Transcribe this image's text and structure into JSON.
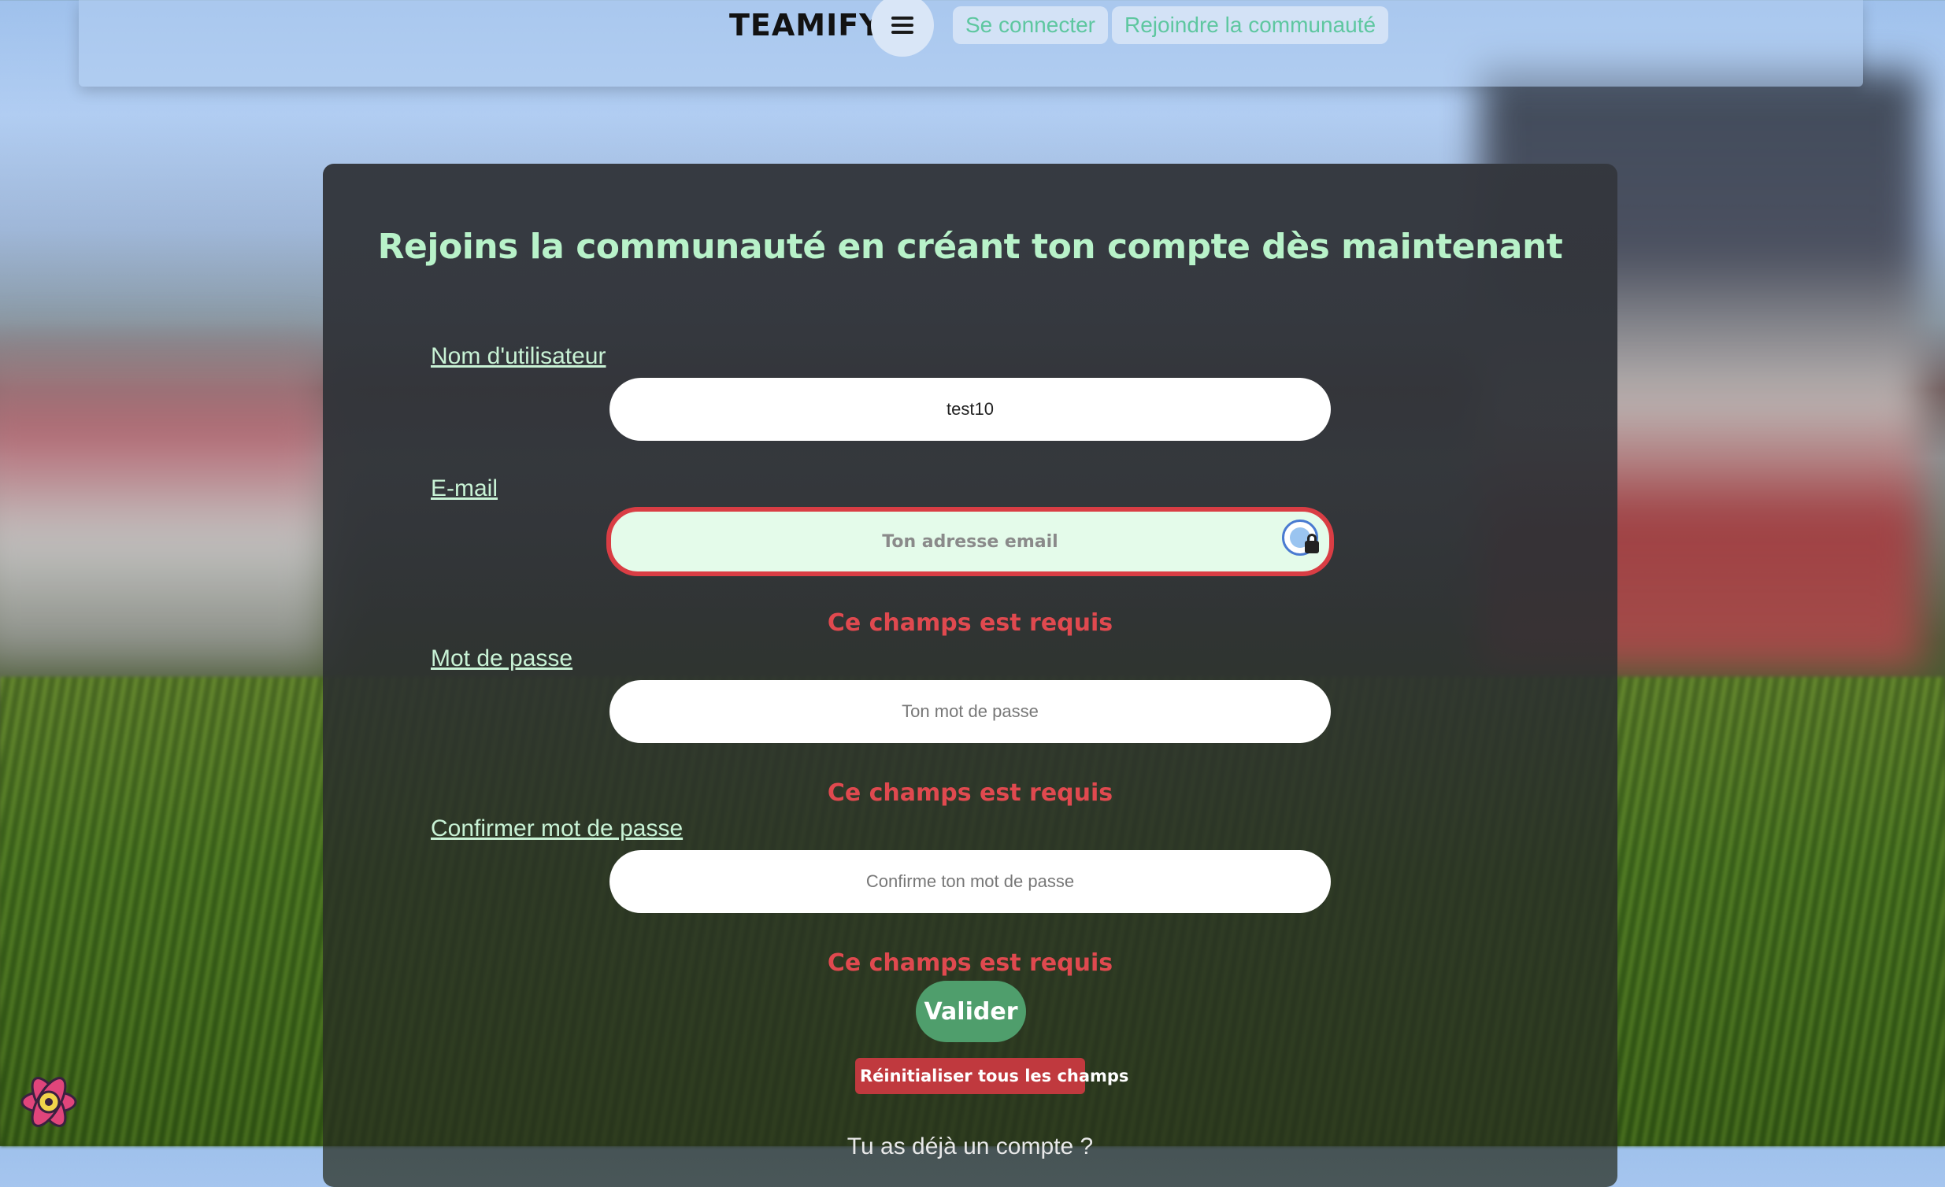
{
  "navbar": {
    "brand": "TEAMIFY",
    "menu_icon": "hamburger-menu-icon",
    "login_label": "Se connecter",
    "join_label": "Rejoindre la communauté"
  },
  "form": {
    "title": "Rejoins la communauté en créant ton compte dès maintenant",
    "username": {
      "label": "Nom d'utilisateur",
      "value": "test10",
      "placeholder": ""
    },
    "email": {
      "label": "E-mail",
      "value": "",
      "placeholder": "Ton adresse email",
      "error": "Ce champs est requis"
    },
    "password": {
      "label": "Mot de passe",
      "value": "",
      "placeholder": "Ton mot de passe",
      "error": "Ce champs est requis"
    },
    "confirm": {
      "label": "Confirmer mot de passe",
      "value": "",
      "placeholder": "Confirme ton mot de passe",
      "error": "Ce champs est requis"
    },
    "submit_label": "Valider",
    "reset_label": "Réinitialiser tous les champs",
    "footer_text": "Tu as déjà un compte ?"
  },
  "colors": {
    "accent_green": "#b8f2c9",
    "error_red": "#e0494f",
    "submit_green": "#4f9e6c",
    "reset_red": "#c0393e"
  },
  "devtools_icon": "react-devtools-icon"
}
